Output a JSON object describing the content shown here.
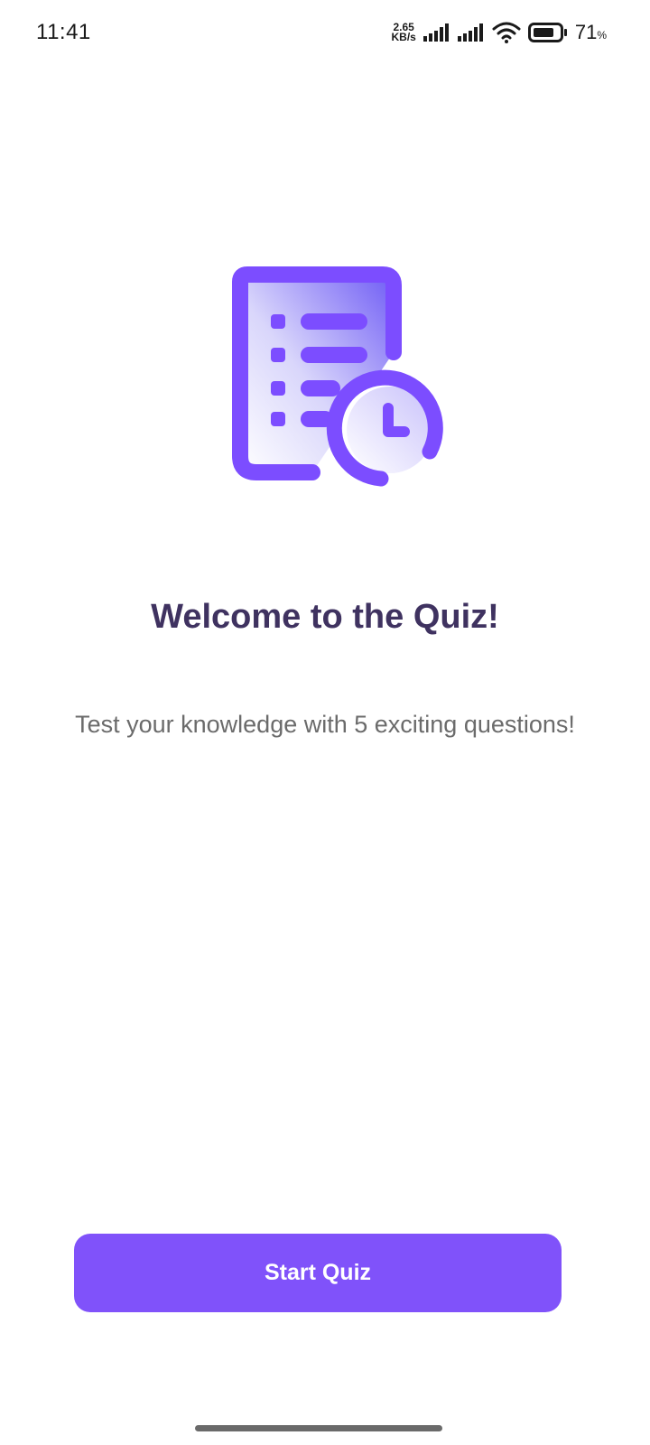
{
  "status_bar": {
    "time": "11:41",
    "net_speed_value": "2.65",
    "net_speed_unit": "KB/s",
    "battery_value": "71",
    "battery_unit": "%"
  },
  "illustration": {
    "icon": "quiz-document-clock-icon",
    "accent_color": "#7c4dff"
  },
  "welcome": {
    "title": "Welcome to the Quiz!",
    "subtitle": "Test your knowledge with 5 exciting questions!"
  },
  "actions": {
    "start_label": "Start Quiz",
    "start_color": "#8052fa"
  }
}
